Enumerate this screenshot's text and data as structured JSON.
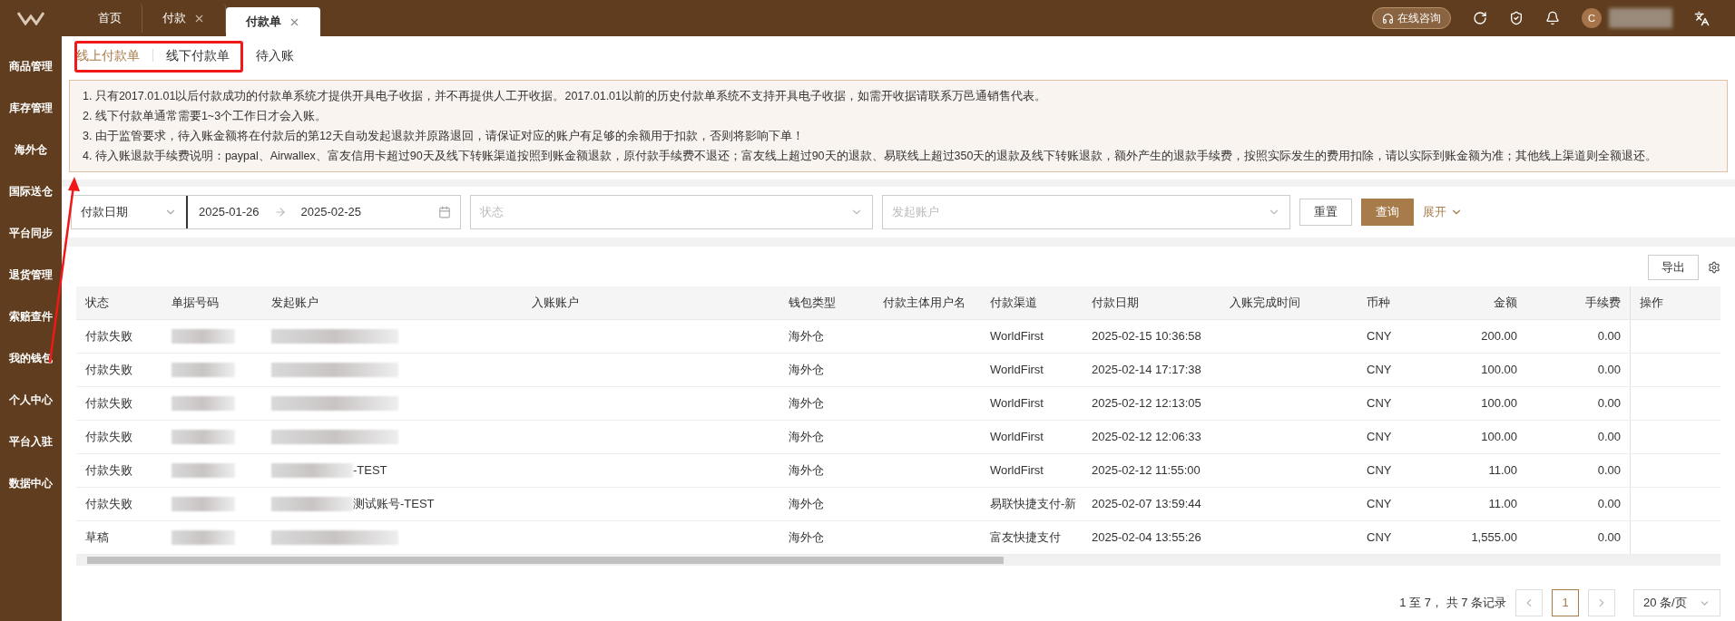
{
  "top_bar": {
    "tabs": [
      {
        "label": "首页",
        "closable": false,
        "selected": false
      },
      {
        "label": "付款",
        "closable": true,
        "selected": false
      },
      {
        "label": "付款单",
        "closable": true,
        "selected": true
      }
    ],
    "consult_button": "在线咨询",
    "avatar_letter": "C"
  },
  "sidebar": {
    "items": [
      {
        "label": "商品管理"
      },
      {
        "label": "库存管理"
      },
      {
        "label": "海外仓"
      },
      {
        "label": "国际送仓"
      },
      {
        "label": "平台同步"
      },
      {
        "label": "退货管理"
      },
      {
        "label": "索赔查件"
      },
      {
        "label": "我的钱包"
      },
      {
        "label": "个人中心"
      },
      {
        "label": "平台入驻"
      },
      {
        "label": "数据中心"
      }
    ]
  },
  "sub_tabs": [
    {
      "label": "线上付款单",
      "selected": true
    },
    {
      "label": "线下付款单",
      "selected": false
    },
    {
      "label": "待入账",
      "selected": false
    }
  ],
  "notices": [
    "1. 只有2017.01.01以后付款成功的付款单系统才提供开具电子收据，并不再提供人工开收据。2017.01.01以前的历史付款单系统不支持开具电子收据，如需开收据请联系万邑通销售代表。",
    "2. 线下付款单通常需要1~3个工作日才会入账。",
    "3. 由于监管要求，待入账金额将在付款后的第12天自动发起退款并原路退回，请保证对应的账户有足够的余额用于扣款，否则将影响下单！",
    "4. 待入账退款手续费说明：paypal、Airwallex、富友信用卡超过90天及线下转账渠道按照到账金额退款，原付款手续费不退还；富友线上超过90天的退款、易联线上超过350天的退款及线下转账退款，额外产生的退款手续费，按照实际发生的费用扣除，请以实际到账金额为准；其他线上渠道则全额退还。"
  ],
  "filters": {
    "date_type": "付款日期",
    "date_start": "2025-01-26",
    "date_end": "2025-02-25",
    "status_placeholder": "状态",
    "account_placeholder": "发起账户",
    "reset_button": "重置",
    "search_button": "查询",
    "expand_link": "展开"
  },
  "export_button": "导出",
  "table": {
    "columns": [
      "状态",
      "单据号码",
      "发起账户",
      "入账账户",
      "钱包类型",
      "付款主体用户名",
      "付款渠道",
      "付款日期",
      "入账完成时间",
      "币种",
      "金额",
      "手续费",
      "操作"
    ],
    "rows": [
      {
        "status": "付款失败",
        "redacted": true,
        "wallet": "海外仓",
        "channel": "WorldFirst",
        "date": "2025-02-15 10:36:58",
        "currency": "CNY",
        "amount": "200.00",
        "fee": "0.00"
      },
      {
        "status": "付款失败",
        "redacted": true,
        "wallet": "海外仓",
        "channel": "WorldFirst",
        "date": "2025-02-14 17:17:38",
        "currency": "CNY",
        "amount": "100.00",
        "fee": "0.00"
      },
      {
        "status": "付款失败",
        "redacted": true,
        "wallet": "海外仓",
        "channel": "WorldFirst",
        "date": "2025-02-12 12:13:05",
        "currency": "CNY",
        "amount": "100.00",
        "fee": "0.00"
      },
      {
        "status": "付款失败",
        "redacted": true,
        "wallet": "海外仓",
        "channel": "WorldFirst",
        "date": "2025-02-12 12:06:33",
        "currency": "CNY",
        "amount": "100.00",
        "fee": "0.00"
      },
      {
        "status": "付款失败",
        "redacted": true,
        "account": "-TEST",
        "wallet": "海外仓",
        "channel": "WorldFirst",
        "date": "2025-02-12 11:55:00",
        "currency": "CNY",
        "amount": "11.00",
        "fee": "0.00"
      },
      {
        "status": "付款失败",
        "redacted": true,
        "account": "测试账号-TEST",
        "wallet": "海外仓",
        "channel": "易联快捷支付-新",
        "date": "2025-02-07 13:59:44",
        "currency": "CNY",
        "amount": "11.00",
        "fee": "0.00"
      },
      {
        "status": "草稿",
        "redacted": true,
        "wallet": "海外仓",
        "channel": "富友快捷支付",
        "date": "2025-02-04 13:55:26",
        "currency": "CNY",
        "amount": "1,555.00",
        "fee": "0.00"
      }
    ]
  },
  "pagination": {
    "summary": "1 至 7， 共 7 条记录",
    "pages": [
      {
        "label": "1",
        "selected": true
      }
    ],
    "page_size": "20 条/页"
  }
}
